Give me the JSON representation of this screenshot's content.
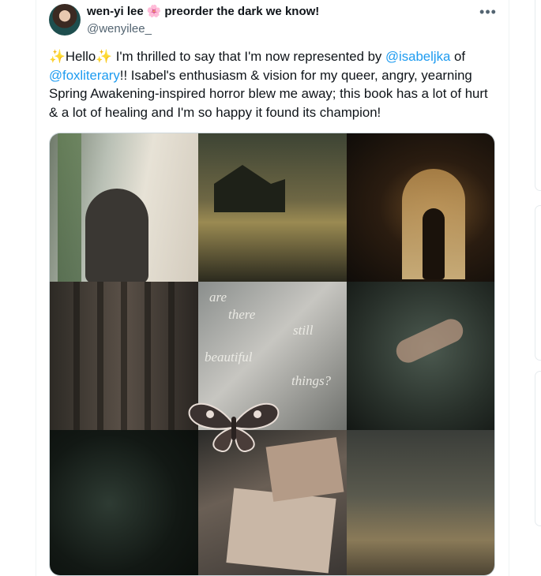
{
  "author": {
    "display_name": "wen-yi lee",
    "name_suffix": "preorder the dark we know!",
    "handle": "@wenyilee_"
  },
  "tweet": {
    "sparkle": "✨",
    "greeting": "Hello",
    "text_before_mention1": " I'm thrilled to say that I'm now represented by ",
    "mention1": "@isabeljka",
    "text_between_mentions": " of ",
    "mention2": "@foxliterary",
    "text_after_mention2": "!! Isabel's enthusiasm & vision for my queer, angry, yearning Spring Awakening-inspired horror blew me away; this book has a lot of hurt & a lot of healing and I'm so happy it found its champion!"
  },
  "media": {
    "poem_lines": [
      "are",
      "there",
      "still",
      "beautiful",
      "things?"
    ]
  },
  "icons": {
    "more": "more-options-icon",
    "blossom": "cherry-blossom-icon"
  },
  "colors": {
    "link": "#1d9bf0",
    "secondary_text": "#536471"
  }
}
